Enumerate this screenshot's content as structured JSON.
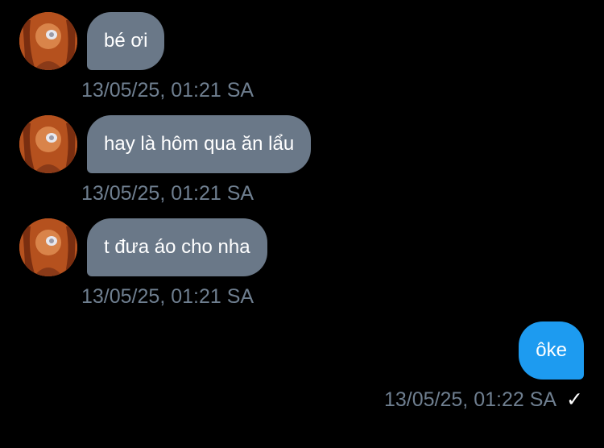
{
  "messages": [
    {
      "sender": "them",
      "avatar_icon": "profile-photo-icon",
      "text": "bé ơi",
      "time": "13/05/25, 01:21 SA"
    },
    {
      "sender": "them",
      "avatar_icon": "profile-photo-icon",
      "text": "hay là hôm qua ăn lẩu",
      "time": "13/05/25, 01:21 SA"
    },
    {
      "sender": "them",
      "avatar_icon": "profile-photo-icon",
      "text": "t đưa áo cho nha",
      "time": "13/05/25, 01:21 SA"
    },
    {
      "sender": "me",
      "text": "ôke",
      "time": "13/05/25, 01:22 SA",
      "status_icon": "checkmark-icon",
      "status_glyph": "✓"
    }
  ],
  "colors": {
    "background": "#000000",
    "incoming_bubble": "#6a7888",
    "outgoing_bubble": "#1d9bf0",
    "timestamp": "#6f7f90",
    "text": "#ffffff"
  }
}
